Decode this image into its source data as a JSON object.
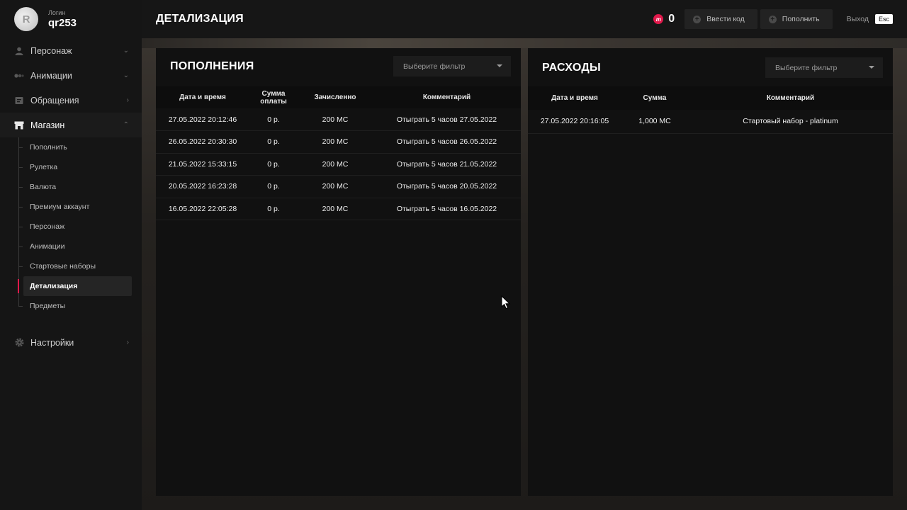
{
  "profile": {
    "login_label": "Логин",
    "login_value": "qr253",
    "avatar_letter": "R"
  },
  "sidebar": {
    "items": [
      {
        "label": "Персонаж",
        "icon": "person-icon"
      },
      {
        "label": "Анимации",
        "icon": "animation-icon"
      },
      {
        "label": "Обращения",
        "icon": "ticket-icon"
      },
      {
        "label": "Магазин",
        "icon": "store-icon"
      },
      {
        "label": "Настройки",
        "icon": "gear-icon"
      }
    ],
    "shop_submenu": [
      "Пополнить",
      "Рулетка",
      "Валюта",
      "Премиум аккаунт",
      "Персонаж",
      "Анимации",
      "Стартовые наборы",
      "Детализация",
      "Предметы"
    ],
    "active_subitem": "Детализация"
  },
  "header": {
    "title": "ДЕТАЛИЗАЦИЯ",
    "coin_symbol": "m",
    "balance": "0",
    "enter_code": "Ввести код",
    "top_up": "Пополнить",
    "exit_label": "Выход",
    "esc_key": "Esc"
  },
  "deposits": {
    "title": "ПОПОЛНЕНИЯ",
    "filter_placeholder": "Выберите фильтр",
    "columns": [
      "Дата и время",
      "Сумма оплаты",
      "Зачисленно",
      "Комментарий"
    ],
    "rows": [
      [
        "27.05.2022 20:12:46",
        "0 р.",
        "200 MC",
        "Отыграть 5 часов 27.05.2022"
      ],
      [
        "26.05.2022 20:30:30",
        "0 р.",
        "200 MC",
        "Отыграть 5 часов 26.05.2022"
      ],
      [
        "21.05.2022 15:33:15",
        "0 р.",
        "200 MC",
        "Отыграть 5 часов 21.05.2022"
      ],
      [
        "20.05.2022 16:23:28",
        "0 р.",
        "200 MC",
        "Отыграть 5 часов 20.05.2022"
      ],
      [
        "16.05.2022 22:05:28",
        "0 р.",
        "200 MC",
        "Отыграть 5 часов 16.05.2022"
      ]
    ]
  },
  "expenses": {
    "title": "РАСХОДЫ",
    "filter_placeholder": "Выберите фильтр",
    "columns": [
      "Дата и время",
      "Сумма",
      "Комментарий"
    ],
    "rows": [
      [
        "27.05.2022 20:16:05",
        "1,000 MC",
        "Стартовый набор - platinum"
      ]
    ]
  },
  "colors": {
    "accent": "#e0194b",
    "panel": "#111111",
    "sidebar": "#151515"
  }
}
